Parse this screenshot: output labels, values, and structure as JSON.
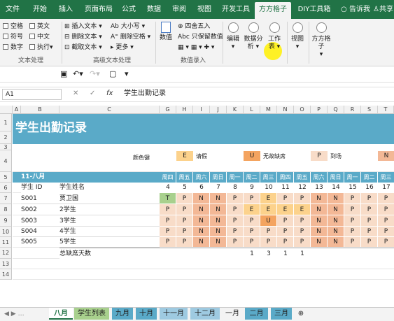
{
  "tabs": [
    "文件",
    "开始",
    "插入",
    "页面布局",
    "公式",
    "数据",
    "审阅",
    "视图",
    "开发工具",
    "方方格子",
    "DIY工具箱",
    "告诉我",
    "共享"
  ],
  "ribbon": {
    "checks": [
      "空格",
      "英文",
      "符号",
      "中文",
      "数字"
    ],
    "exec": "执行",
    "exec_arrow": "▾",
    "text_items": [
      "插入文本",
      "删除文本",
      "截取文本"
    ],
    "case_items": [
      "大小写",
      "删除空格",
      "更多"
    ],
    "num_items": [
      "四舍五入",
      "只保留数值"
    ],
    "num_label": "数值",
    "big_buttons": [
      "编辑",
      "数据分析",
      "工作表",
      "视图",
      "方方格子"
    ],
    "groups": [
      "文本处理",
      "高级文本处理",
      "数值录入"
    ]
  },
  "formula_bar": {
    "name_box": "A1",
    "fx": "fx",
    "formula": "学生出勤记录"
  },
  "columns": [
    "A",
    "B",
    "C",
    "G",
    "H",
    "I",
    "J",
    "K",
    "L",
    "M",
    "N",
    "O",
    "P",
    "Q",
    "R",
    "S",
    "T"
  ],
  "rows": [
    "1",
    "2",
    "3",
    "4",
    "5",
    "6",
    "7",
    "8",
    "9",
    "10",
    "11",
    "12",
    "13",
    "14"
  ],
  "sheet": {
    "title": "学生出勤记录",
    "legend_label": "颜色键",
    "legend": [
      {
        "code": "E",
        "text": "请假"
      },
      {
        "code": "U",
        "text": "无故缺席"
      },
      {
        "code": "P",
        "text": "到场"
      },
      {
        "code": "N",
        "text": ""
      }
    ],
    "month": "11-八月",
    "weekdays": [
      "周四",
      "周五",
      "周六",
      "周日",
      "周一",
      "周二",
      "周三",
      "周四",
      "周五",
      "周六",
      "周日",
      "周一",
      "周二",
      "周三"
    ],
    "dates": [
      "4",
      "5",
      "6",
      "7",
      "8",
      "9",
      "10",
      "11",
      "12",
      "13",
      "14",
      "15",
      "16",
      "17"
    ],
    "h_id": "学生 ID",
    "h_name": "学生姓名",
    "students": [
      {
        "id": "S001",
        "name": "贾卫国",
        "marks": [
          "T",
          "P",
          "N",
          "N",
          "P",
          "P",
          "E",
          "P",
          "P",
          "N",
          "N",
          "P",
          "P",
          "P"
        ]
      },
      {
        "id": "S002",
        "name": "2学生",
        "marks": [
          "P",
          "P",
          "N",
          "N",
          "P",
          "E",
          "E",
          "E",
          "E",
          "N",
          "N",
          "P",
          "P",
          "P"
        ]
      },
      {
        "id": "S003",
        "name": "3学生",
        "marks": [
          "P",
          "P",
          "N",
          "N",
          "P",
          "P",
          "U",
          "P",
          "P",
          "N",
          "N",
          "P",
          "P",
          "P"
        ]
      },
      {
        "id": "S004",
        "name": "4学生",
        "marks": [
          "P",
          "P",
          "N",
          "N",
          "P",
          "P",
          "P",
          "P",
          "P",
          "N",
          "N",
          "P",
          "P",
          "P"
        ]
      },
      {
        "id": "S005",
        "name": "5学生",
        "marks": [
          "P",
          "P",
          "N",
          "N",
          "P",
          "P",
          "P",
          "P",
          "P",
          "N",
          "N",
          "P",
          "P",
          "P"
        ]
      }
    ],
    "total_label": "总缺席天数",
    "totals": [
      "",
      "",
      "",
      "",
      "",
      "1",
      "3",
      "1",
      "1",
      "",
      "",
      "",
      "",
      ""
    ]
  },
  "sheet_tabs": [
    "八月",
    "学生列表",
    "九月",
    "十月",
    "十一月",
    "十二月",
    "一月",
    "二月",
    "三月"
  ],
  "colors": {
    "green": "#217346",
    "teal": "#5aaac8",
    "E": "#fcd28c",
    "U": "#f4a460",
    "P": "#f8dcc8",
    "N": "#f3b896",
    "T": "#a8d08d"
  }
}
